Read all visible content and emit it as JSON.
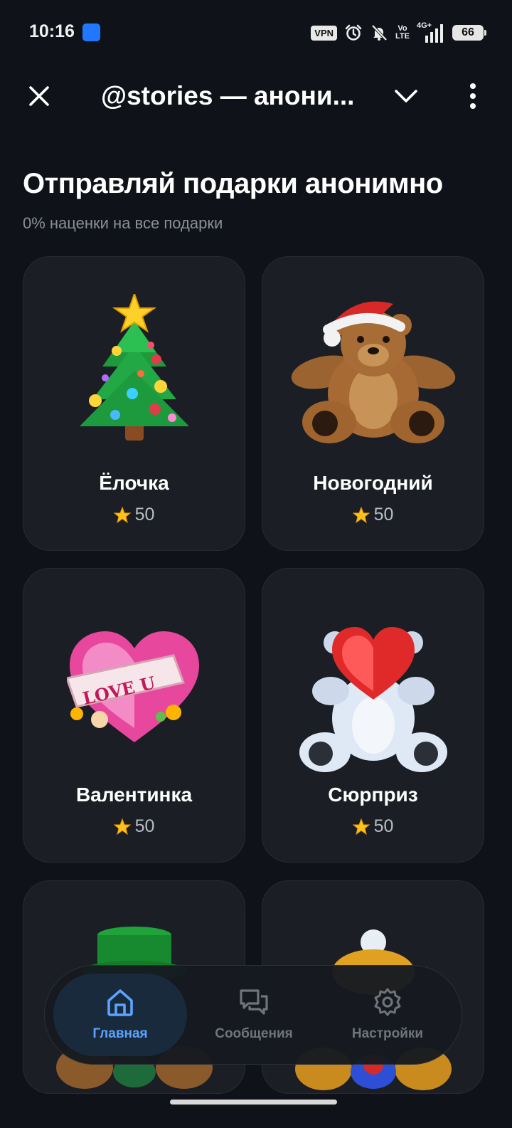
{
  "status_bar": {
    "time": "10:16",
    "vpn": "VPN",
    "volte_top": "Vo",
    "volte_bottom": "LTE",
    "network": "4G+",
    "battery": "66"
  },
  "header": {
    "title": "@stories — анони..."
  },
  "headline": {
    "title": "Отправляй подарки анонимно",
    "subtitle": "0% наценки на все подарки"
  },
  "gifts": [
    {
      "name": "Ёлочка",
      "price": "50",
      "icon": "christmas-tree"
    },
    {
      "name": "Новогодний",
      "price": "50",
      "icon": "teddy-bear-santa-hat"
    },
    {
      "name": "Валентинка",
      "price": "50",
      "icon": "heart-love-u"
    },
    {
      "name": "Сюрприз",
      "price": "50",
      "icon": "bear-with-heart"
    },
    {
      "name": "",
      "price": "",
      "icon": "green-hat"
    },
    {
      "name": "",
      "price": "",
      "icon": "bear-in-hat"
    }
  ],
  "heart_banner_text": "LOVE U",
  "nav": {
    "items": [
      {
        "label": "Главная",
        "icon": "home-icon",
        "active": true
      },
      {
        "label": "Сообщения",
        "icon": "messages-icon",
        "active": false
      },
      {
        "label": "Настройки",
        "icon": "settings-icon",
        "active": false
      }
    ]
  },
  "colors": {
    "background": "#0f1319",
    "card": "#1b1f25",
    "accent": "#5aa4ff",
    "star": "#ffc21a"
  }
}
